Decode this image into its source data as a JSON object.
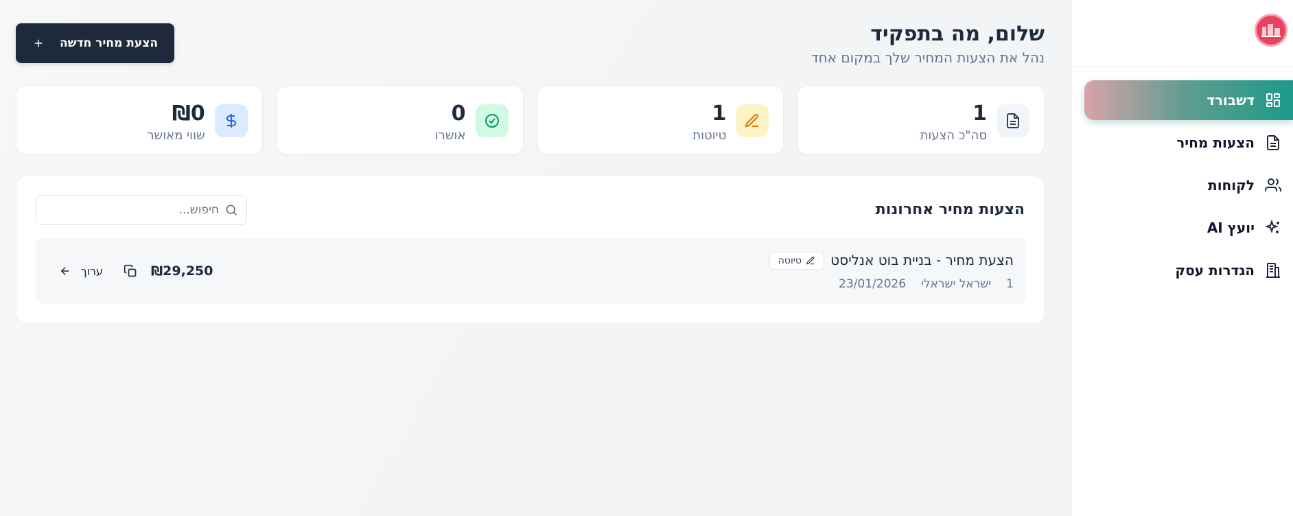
{
  "header": {
    "title": "שלום, מה בתפקיד",
    "subtitle": "נהל את הצעות המחיר שלך במקום אחד",
    "new_quote_label": "הצעת מחיר חדשה"
  },
  "sidebar": {
    "items": [
      {
        "label": "דשבורד",
        "icon": "dashboard-grid-icon",
        "active": true
      },
      {
        "label": "הצעות מחיר",
        "icon": "document-icon"
      },
      {
        "label": "לקוחות",
        "icon": "users-icon"
      },
      {
        "label": "יועץ AI",
        "icon": "sparkles-icon"
      },
      {
        "label": "הגדרות עסק",
        "icon": "building-icon"
      }
    ]
  },
  "stats": [
    {
      "value": "1",
      "label": "סה\"כ הצעות",
      "icon": "document-icon",
      "color": "#f1f5f9"
    },
    {
      "value": "1",
      "label": "טיוטות",
      "icon": "pencil-icon",
      "color": "#fef3c7"
    },
    {
      "value": "0",
      "label": "אושרו",
      "icon": "check-circle-icon",
      "color": "#d1fae5"
    },
    {
      "value": "₪0",
      "label": "שווי מאושר",
      "icon": "dollar-icon",
      "color": "#dbeafe"
    }
  ],
  "recent": {
    "title": "הצעות מחיר אחרונות",
    "search_placeholder": "חיפוש...",
    "quotes": [
      {
        "title": "הצעת מחיר - בניית בוט אנליסט",
        "status": "טיוטה",
        "number": "1",
        "client": "ישראל ישראלי",
        "date": "23/01/2026",
        "amount": "₪29,250",
        "edit_label": "ערוך"
      }
    ]
  },
  "colors": {
    "primary_dark": "#1e293b",
    "accent_teal": "#1d9a8a",
    "logo_red": "#e8425f"
  }
}
